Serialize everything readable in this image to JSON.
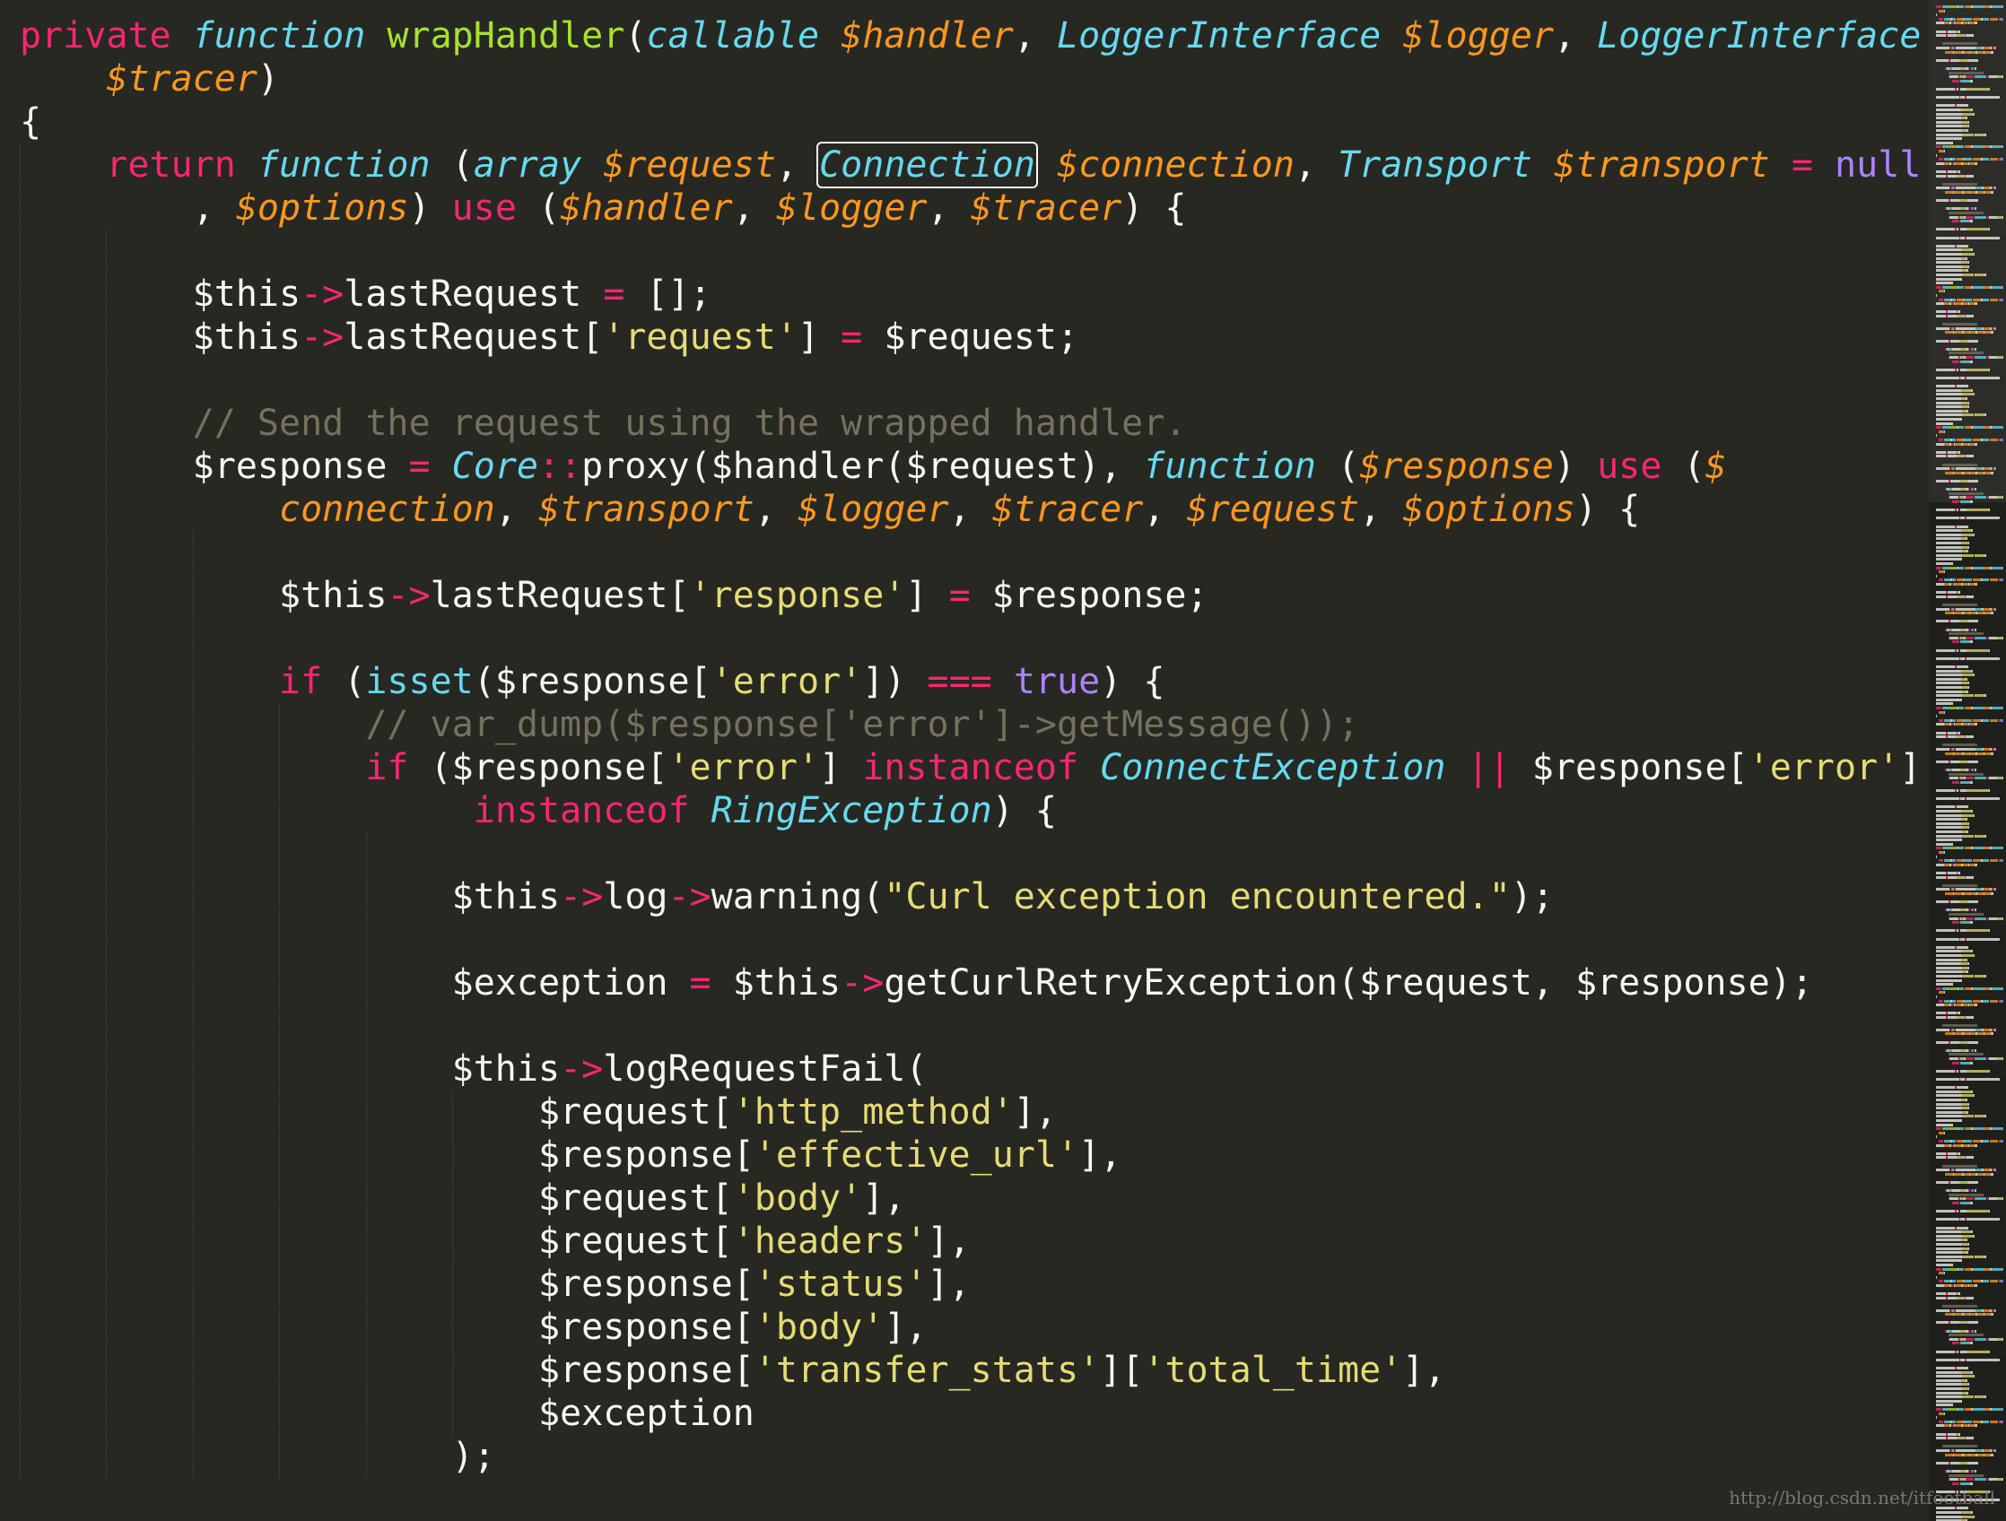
{
  "editor": {
    "theme_colors": {
      "background": "#272822",
      "foreground": "#F8F8F2",
      "keyword": "#F92672",
      "storage_type": "#66D9EF",
      "function_name": "#A6E22E",
      "parameter": "#FD971F",
      "string": "#E6DB74",
      "comment": "#75715E",
      "constant": "#AE81FF"
    },
    "lines": [
      {
        "tokens": [
          {
            "t": "private",
            "c": "kw"
          },
          {
            "t": " "
          },
          {
            "t": "function",
            "c": "st"
          },
          {
            "t": " "
          },
          {
            "t": "wrapHandler",
            "c": "fn"
          },
          {
            "t": "("
          },
          {
            "t": "callable",
            "c": "ty"
          },
          {
            "t": " "
          },
          {
            "t": "$handler",
            "c": "par"
          },
          {
            "t": ", "
          },
          {
            "t": "LoggerInterface",
            "c": "ty"
          },
          {
            "t": " "
          },
          {
            "t": "$logger",
            "c": "par"
          },
          {
            "t": ", "
          },
          {
            "t": "LoggerInterface",
            "c": "ty"
          }
        ]
      },
      {
        "tokens": [
          {
            "t": "    "
          },
          {
            "t": "$tracer",
            "c": "par"
          },
          {
            "t": ")"
          }
        ]
      },
      {
        "tokens": [
          {
            "t": "{"
          }
        ]
      },
      {
        "tokens": [
          {
            "t": "    "
          },
          {
            "t": "return",
            "c": "kw"
          },
          {
            "t": " "
          },
          {
            "t": "function",
            "c": "st"
          },
          {
            "t": " ("
          },
          {
            "t": "array",
            "c": "ty"
          },
          {
            "t": " "
          },
          {
            "t": "$request",
            "c": "par"
          },
          {
            "t": ", "
          },
          {
            "t": "Connection",
            "c": "ty",
            "box": true
          },
          {
            "t": " "
          },
          {
            "t": "$connection",
            "c": "par"
          },
          {
            "t": ", "
          },
          {
            "t": "Transport",
            "c": "ty"
          },
          {
            "t": " "
          },
          {
            "t": "$transport",
            "c": "par"
          },
          {
            "t": " "
          },
          {
            "t": "=",
            "c": "op"
          },
          {
            "t": " "
          },
          {
            "t": "null",
            "c": "con"
          }
        ]
      },
      {
        "tokens": [
          {
            "t": "        , "
          },
          {
            "t": "$options",
            "c": "par"
          },
          {
            "t": ") "
          },
          {
            "t": "use",
            "c": "kw"
          },
          {
            "t": " ("
          },
          {
            "t": "$handler",
            "c": "par"
          },
          {
            "t": ", "
          },
          {
            "t": "$logger",
            "c": "par"
          },
          {
            "t": ", "
          },
          {
            "t": "$tracer",
            "c": "par"
          },
          {
            "t": ") {"
          }
        ]
      },
      {
        "tokens": []
      },
      {
        "tokens": [
          {
            "t": "        $this"
          },
          {
            "t": "->",
            "c": "op"
          },
          {
            "t": "lastRequest "
          },
          {
            "t": "=",
            "c": "op"
          },
          {
            "t": " [];"
          }
        ]
      },
      {
        "tokens": [
          {
            "t": "        $this"
          },
          {
            "t": "->",
            "c": "op"
          },
          {
            "t": "lastRequest["
          },
          {
            "t": "'request'",
            "c": "str"
          },
          {
            "t": "] "
          },
          {
            "t": "=",
            "c": "op"
          },
          {
            "t": " $request;"
          }
        ]
      },
      {
        "tokens": []
      },
      {
        "tokens": [
          {
            "t": "        "
          },
          {
            "t": "// Send the request using the wrapped handler.",
            "c": "cm"
          }
        ]
      },
      {
        "tokens": [
          {
            "t": "        $response "
          },
          {
            "t": "=",
            "c": "op"
          },
          {
            "t": " "
          },
          {
            "t": "Core",
            "c": "ty"
          },
          {
            "t": "::",
            "c": "op"
          },
          {
            "t": "proxy($handler($request), "
          },
          {
            "t": "function",
            "c": "st"
          },
          {
            "t": " ("
          },
          {
            "t": "$response",
            "c": "par"
          },
          {
            "t": ") "
          },
          {
            "t": "use",
            "c": "kw"
          },
          {
            "t": " ("
          },
          {
            "t": "$",
            "c": "par"
          }
        ]
      },
      {
        "tokens": [
          {
            "t": "            "
          },
          {
            "t": "connection",
            "c": "par"
          },
          {
            "t": ", "
          },
          {
            "t": "$transport",
            "c": "par"
          },
          {
            "t": ", "
          },
          {
            "t": "$logger",
            "c": "par"
          },
          {
            "t": ", "
          },
          {
            "t": "$tracer",
            "c": "par"
          },
          {
            "t": ", "
          },
          {
            "t": "$request",
            "c": "par"
          },
          {
            "t": ", "
          },
          {
            "t": "$options",
            "c": "par"
          },
          {
            "t": ") {"
          }
        ]
      },
      {
        "tokens": []
      },
      {
        "tokens": [
          {
            "t": "            $this"
          },
          {
            "t": "->",
            "c": "op"
          },
          {
            "t": "lastRequest["
          },
          {
            "t": "'response'",
            "c": "str"
          },
          {
            "t": "] "
          },
          {
            "t": "=",
            "c": "op"
          },
          {
            "t": " $response;"
          }
        ]
      },
      {
        "tokens": []
      },
      {
        "tokens": [
          {
            "t": "            "
          },
          {
            "t": "if",
            "c": "kw"
          },
          {
            "t": " ("
          },
          {
            "t": "isset",
            "c": "bi"
          },
          {
            "t": "($response["
          },
          {
            "t": "'error'",
            "c": "str"
          },
          {
            "t": "]) "
          },
          {
            "t": "===",
            "c": "op"
          },
          {
            "t": " "
          },
          {
            "t": "true",
            "c": "con"
          },
          {
            "t": ") {"
          }
        ]
      },
      {
        "tokens": [
          {
            "t": "                "
          },
          {
            "t": "// var_dump($response['error']->getMessage());",
            "c": "cm"
          }
        ]
      },
      {
        "tokens": [
          {
            "t": "                "
          },
          {
            "t": "if",
            "c": "kw"
          },
          {
            "t": " ($response["
          },
          {
            "t": "'error'",
            "c": "str"
          },
          {
            "t": "] "
          },
          {
            "t": "instanceof",
            "c": "kw"
          },
          {
            "t": " "
          },
          {
            "t": "ConnectException",
            "c": "ty"
          },
          {
            "t": " "
          },
          {
            "t": "||",
            "c": "op"
          },
          {
            "t": " $response["
          },
          {
            "t": "'error'",
            "c": "str"
          },
          {
            "t": "]"
          }
        ]
      },
      {
        "tokens": [
          {
            "t": "                     "
          },
          {
            "t": "instanceof",
            "c": "kw"
          },
          {
            "t": " "
          },
          {
            "t": "RingException",
            "c": "ty"
          },
          {
            "t": ") {"
          }
        ]
      },
      {
        "tokens": []
      },
      {
        "tokens": [
          {
            "t": "                    $this"
          },
          {
            "t": "->",
            "c": "op"
          },
          {
            "t": "log"
          },
          {
            "t": "->",
            "c": "op"
          },
          {
            "t": "warning("
          },
          {
            "t": "\"Curl exception encountered.\"",
            "c": "str"
          },
          {
            "t": ");"
          }
        ]
      },
      {
        "tokens": []
      },
      {
        "tokens": [
          {
            "t": "                    $exception "
          },
          {
            "t": "=",
            "c": "op"
          },
          {
            "t": " $this"
          },
          {
            "t": "->",
            "c": "op"
          },
          {
            "t": "getCurlRetryException($request, $response);"
          }
        ]
      },
      {
        "tokens": []
      },
      {
        "tokens": [
          {
            "t": "                    $this"
          },
          {
            "t": "->",
            "c": "op"
          },
          {
            "t": "logRequestFail("
          }
        ]
      },
      {
        "tokens": [
          {
            "t": "                        $request["
          },
          {
            "t": "'http_method'",
            "c": "str"
          },
          {
            "t": "],"
          }
        ]
      },
      {
        "tokens": [
          {
            "t": "                        $response["
          },
          {
            "t": "'effective_url'",
            "c": "str"
          },
          {
            "t": "],"
          }
        ]
      },
      {
        "tokens": [
          {
            "t": "                        $request["
          },
          {
            "t": "'body'",
            "c": "str"
          },
          {
            "t": "],"
          }
        ]
      },
      {
        "tokens": [
          {
            "t": "                        $request["
          },
          {
            "t": "'headers'",
            "c": "str"
          },
          {
            "t": "],"
          }
        ]
      },
      {
        "tokens": [
          {
            "t": "                        $response["
          },
          {
            "t": "'status'",
            "c": "str"
          },
          {
            "t": "],"
          }
        ]
      },
      {
        "tokens": [
          {
            "t": "                        $response["
          },
          {
            "t": "'body'",
            "c": "str"
          },
          {
            "t": "],"
          }
        ]
      },
      {
        "tokens": [
          {
            "t": "                        $response["
          },
          {
            "t": "'transfer_stats'",
            "c": "str"
          },
          {
            "t": "]["
          },
          {
            "t": "'total_time'",
            "c": "str"
          },
          {
            "t": "],"
          }
        ]
      },
      {
        "tokens": [
          {
            "t": "                        $exception"
          }
        ]
      },
      {
        "tokens": [
          {
            "t": "                    );"
          }
        ]
      }
    ]
  },
  "minimap": {
    "label": "minimap"
  },
  "watermark": "http://blog.csdn.net/itfootball"
}
